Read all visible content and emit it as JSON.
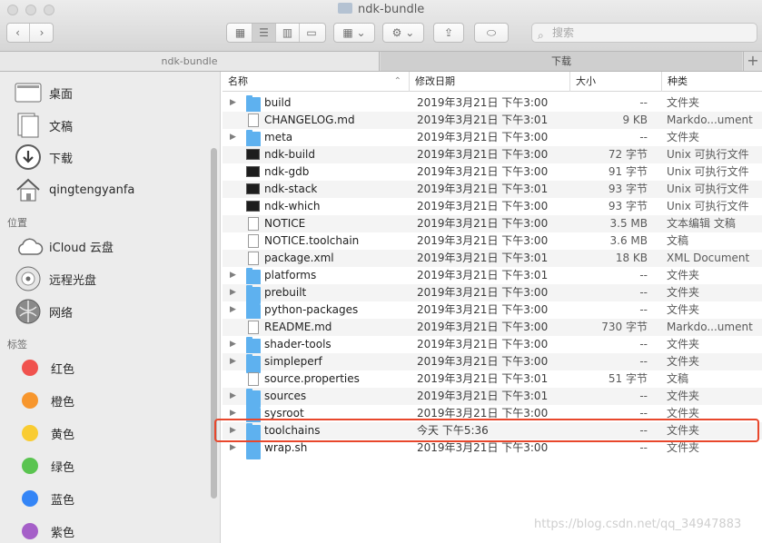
{
  "window": {
    "title": "ndk-bundle"
  },
  "toolbar": {
    "search_placeholder": "搜索",
    "back_icon": "chevron-left-icon",
    "forward_icon": "chevron-right-icon"
  },
  "tabs": [
    {
      "label": "ndk-bundle",
      "active": false
    },
    {
      "label": "下载",
      "active": true
    }
  ],
  "sidebar": {
    "favorites": [
      {
        "label": "桌面",
        "icon": "desktop-icon"
      },
      {
        "label": "文稿",
        "icon": "documents-icon"
      },
      {
        "label": "下载",
        "icon": "downloads-icon"
      },
      {
        "label": "qingtengyanfa",
        "icon": "home-icon"
      }
    ],
    "locations_header": "位置",
    "locations": [
      {
        "label": "iCloud 云盘",
        "icon": "cloud-icon"
      },
      {
        "label": "远程光盘",
        "icon": "disc-icon"
      },
      {
        "label": "网络",
        "icon": "network-icon"
      }
    ],
    "tags_header": "标签",
    "tags": [
      {
        "label": "红色",
        "color": "#f0524e"
      },
      {
        "label": "橙色",
        "color": "#f7962d"
      },
      {
        "label": "黄色",
        "color": "#f9cc32"
      },
      {
        "label": "绿色",
        "color": "#5ac450"
      },
      {
        "label": "蓝色",
        "color": "#3485f6"
      },
      {
        "label": "紫色",
        "color": "#a55fc8"
      }
    ]
  },
  "columns": {
    "name": "名称",
    "date": "修改日期",
    "size": "大小",
    "kind": "种类"
  },
  "files": [
    {
      "name": "build",
      "date": "2019年3月21日 下午3:00",
      "size": "--",
      "kind": "文件夹",
      "type": "folder"
    },
    {
      "name": "CHANGELOG.md",
      "date": "2019年3月21日 下午3:01",
      "size": "9 KB",
      "kind": "Markdo...ument",
      "type": "doc"
    },
    {
      "name": "meta",
      "date": "2019年3月21日 下午3:00",
      "size": "--",
      "kind": "文件夹",
      "type": "folder"
    },
    {
      "name": "ndk-build",
      "date": "2019年3月21日 下午3:00",
      "size": "72 字节",
      "kind": "Unix 可执行文件",
      "type": "exec"
    },
    {
      "name": "ndk-gdb",
      "date": "2019年3月21日 下午3:00",
      "size": "91 字节",
      "kind": "Unix 可执行文件",
      "type": "exec"
    },
    {
      "name": "ndk-stack",
      "date": "2019年3月21日 下午3:01",
      "size": "93 字节",
      "kind": "Unix 可执行文件",
      "type": "exec"
    },
    {
      "name": "ndk-which",
      "date": "2019年3月21日 下午3:00",
      "size": "93 字节",
      "kind": "Unix 可执行文件",
      "type": "exec"
    },
    {
      "name": "NOTICE",
      "date": "2019年3月21日 下午3:00",
      "size": "3.5 MB",
      "kind": "文本编辑 文稿",
      "type": "doc"
    },
    {
      "name": "NOTICE.toolchain",
      "date": "2019年3月21日 下午3:00",
      "size": "3.6 MB",
      "kind": "文稿",
      "type": "doc"
    },
    {
      "name": "package.xml",
      "date": "2019年3月21日 下午3:01",
      "size": "18 KB",
      "kind": "XML Document",
      "type": "doc"
    },
    {
      "name": "platforms",
      "date": "2019年3月21日 下午3:01",
      "size": "--",
      "kind": "文件夹",
      "type": "folder"
    },
    {
      "name": "prebuilt",
      "date": "2019年3月21日 下午3:00",
      "size": "--",
      "kind": "文件夹",
      "type": "folder"
    },
    {
      "name": "python-packages",
      "date": "2019年3月21日 下午3:00",
      "size": "--",
      "kind": "文件夹",
      "type": "folder"
    },
    {
      "name": "README.md",
      "date": "2019年3月21日 下午3:00",
      "size": "730 字节",
      "kind": "Markdo...ument",
      "type": "doc"
    },
    {
      "name": "shader-tools",
      "date": "2019年3月21日 下午3:00",
      "size": "--",
      "kind": "文件夹",
      "type": "folder"
    },
    {
      "name": "simpleperf",
      "date": "2019年3月21日 下午3:00",
      "size": "--",
      "kind": "文件夹",
      "type": "folder"
    },
    {
      "name": "source.properties",
      "date": "2019年3月21日 下午3:01",
      "size": "51 字节",
      "kind": "文稿",
      "type": "doc"
    },
    {
      "name": "sources",
      "date": "2019年3月21日 下午3:01",
      "size": "--",
      "kind": "文件夹",
      "type": "folder"
    },
    {
      "name": "sysroot",
      "date": "2019年3月21日 下午3:00",
      "size": "--",
      "kind": "文件夹",
      "type": "folder"
    },
    {
      "name": "toolchains",
      "date": "今天 下午5:36",
      "size": "--",
      "kind": "文件夹",
      "type": "folder",
      "highlighted": true
    },
    {
      "name": "wrap.sh",
      "date": "2019年3月21日 下午3:00",
      "size": "--",
      "kind": "文件夹",
      "type": "folder"
    }
  ],
  "watermark": "https://blog.csdn.net/qq_34947883"
}
